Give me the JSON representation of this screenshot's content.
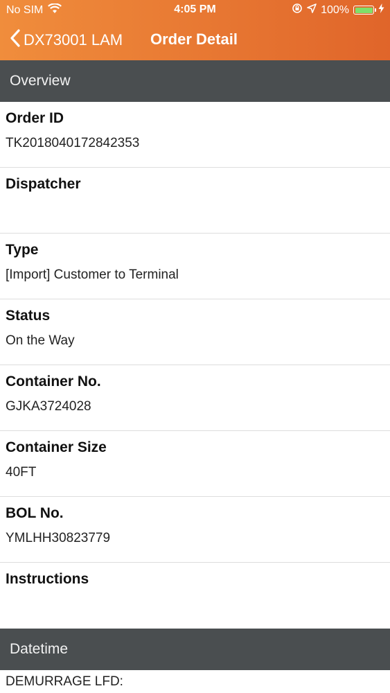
{
  "status_bar": {
    "carrier": "No SIM",
    "time": "4:05 PM",
    "battery_percent": "100%",
    "battery_level": 1.0,
    "icons": [
      "wifi-icon",
      "rotation-lock-icon",
      "location-arrow-icon",
      "battery-icon",
      "charging-bolt-icon"
    ]
  },
  "nav": {
    "back_label": "DX73001 LAM",
    "title": "Order Detail"
  },
  "sections": {
    "overview": "Overview",
    "datetime": "Datetime"
  },
  "fields": [
    {
      "label": "Order ID",
      "value": "TK2018040172842353"
    },
    {
      "label": "Dispatcher",
      "value": ""
    },
    {
      "label": "Type",
      "value": "[Import] Customer to Terminal"
    },
    {
      "label": "Status",
      "value": "On the Way"
    },
    {
      "label": "Container No.",
      "value": "GJKA3724028"
    },
    {
      "label": "Container Size",
      "value": "40FT"
    },
    {
      "label": "BOL No.",
      "value": "YMLHH30823779"
    },
    {
      "label": "Instructions",
      "value": ""
    }
  ],
  "datetime_rows": [
    {
      "label": "DEMURRAGE LFD:"
    }
  ],
  "colors": {
    "header_gradient_start": "#f08d3c",
    "header_gradient_end": "#e0652a",
    "section_header_bg": "#4a4e50",
    "battery_fill": "#7ee06a"
  }
}
